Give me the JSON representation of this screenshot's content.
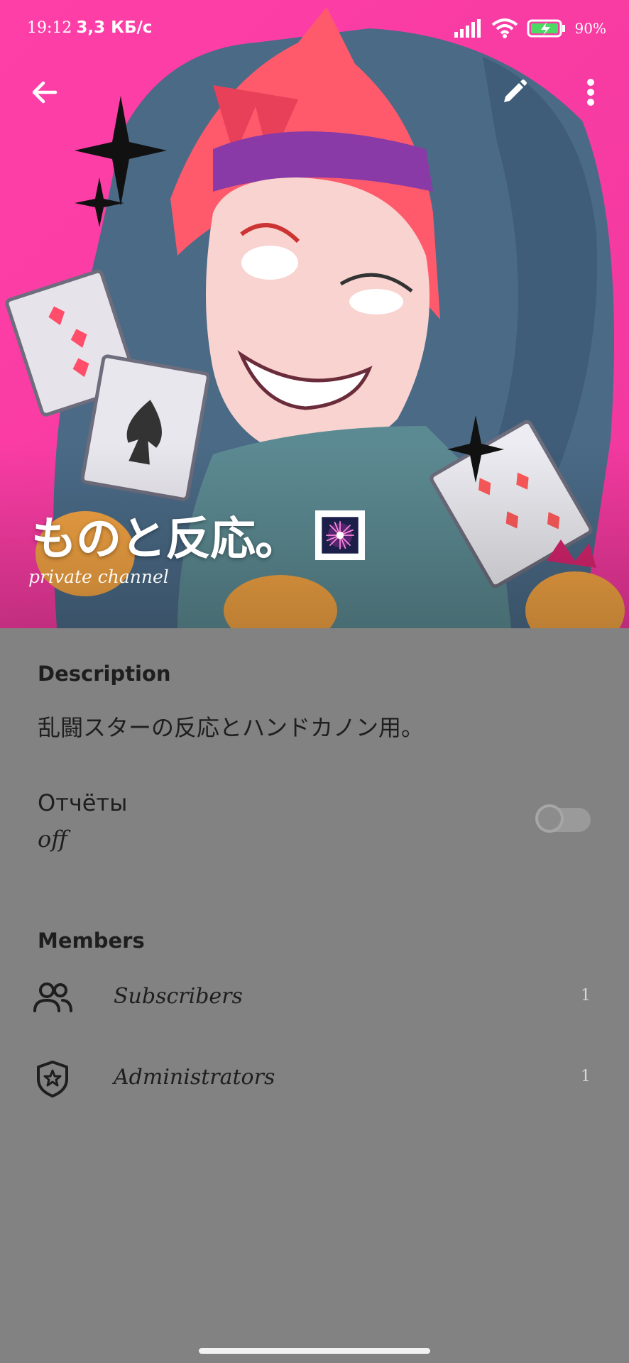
{
  "status_bar": {
    "time": "19:12",
    "speed": "3,3 КБ/с",
    "battery": "90%"
  },
  "header": {
    "channel_name": "ものと反応。",
    "channel_type": "private channel",
    "icons": [
      "back-arrow-icon",
      "pencil-icon",
      "more-vertical-icon"
    ]
  },
  "description": {
    "heading": "Description",
    "text": "乱闘スターの反応とハンドカノン用。"
  },
  "reports": {
    "title": "Отчёты",
    "state": "off",
    "enabled": false
  },
  "members": {
    "heading": "Members",
    "items": [
      {
        "label": "Subscribers",
        "count": "1",
        "icon": "people-icon"
      },
      {
        "label": "Administrators",
        "count": "1",
        "icon": "shield-star-icon"
      }
    ]
  },
  "colors": {
    "background": "#838283",
    "cover": "#ff3fa6",
    "accent_text": "#1e1e1e"
  }
}
